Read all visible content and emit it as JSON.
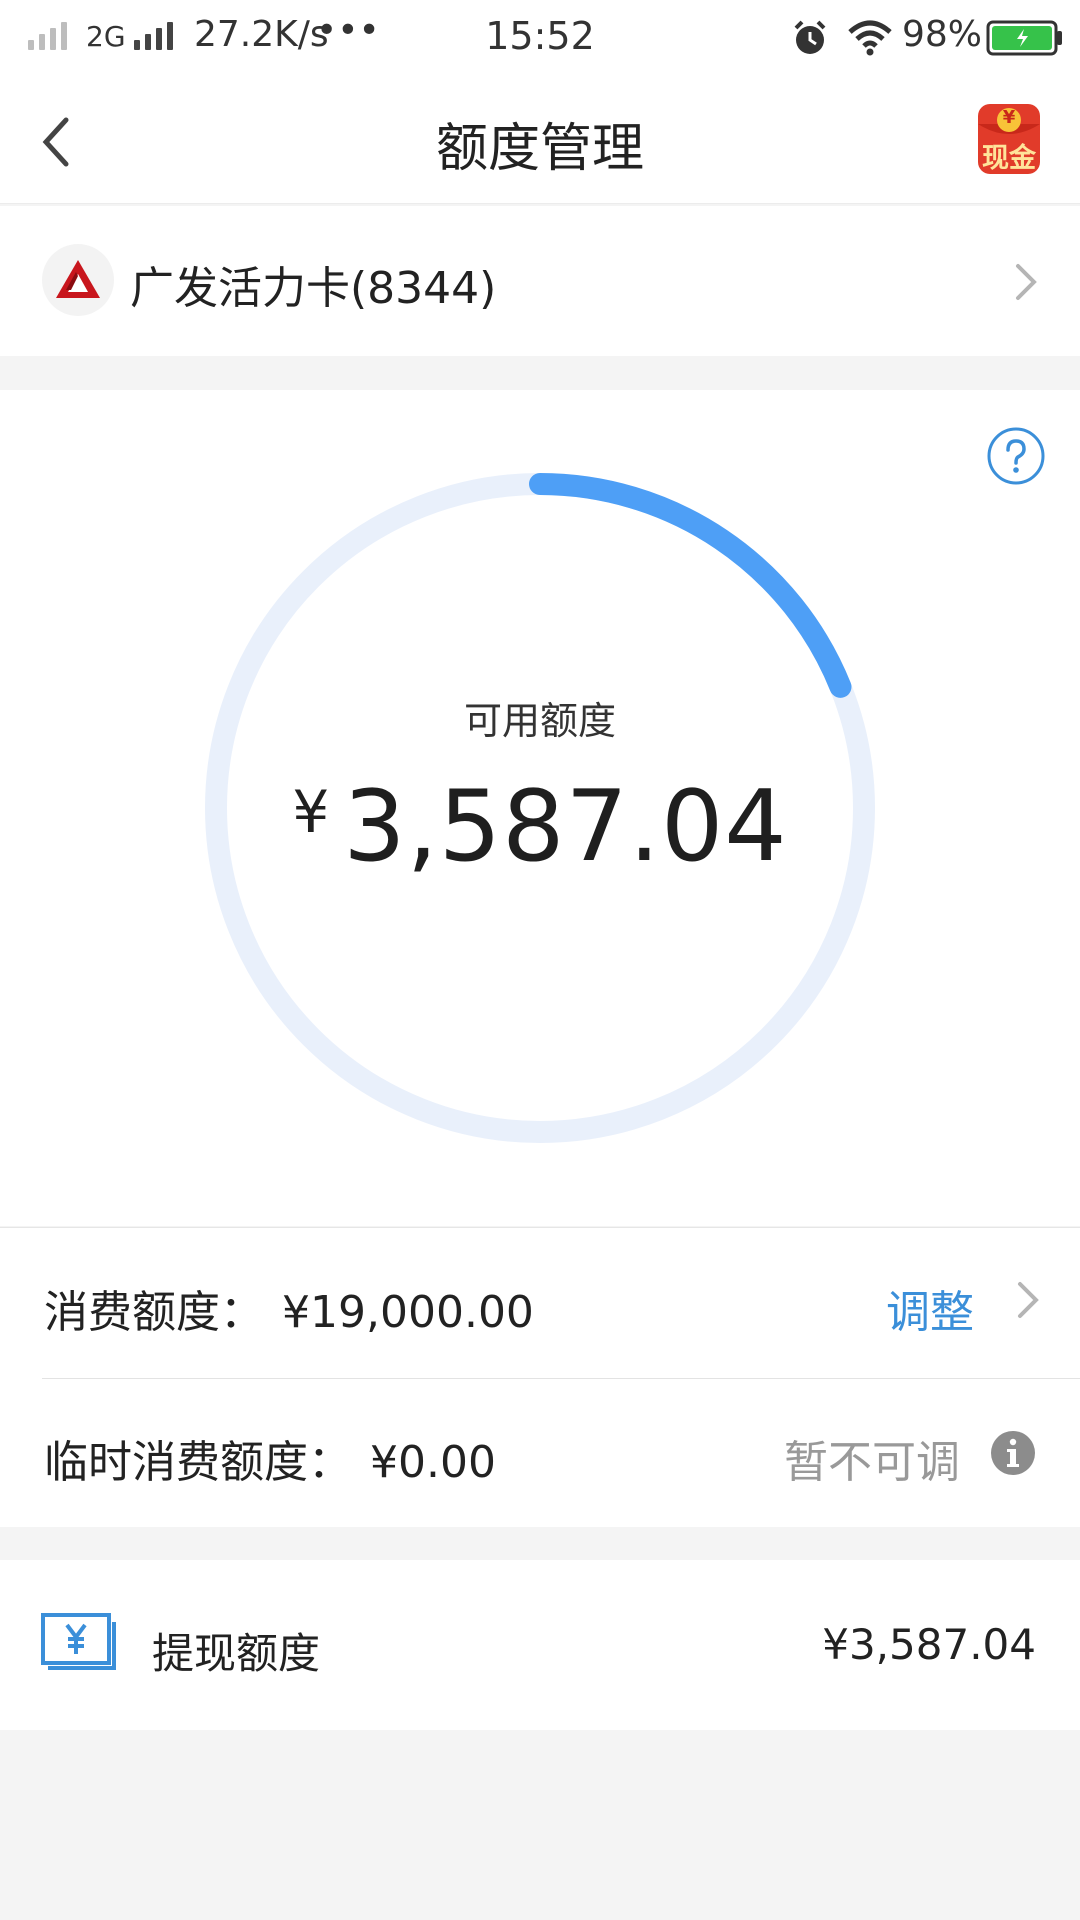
{
  "status_bar": {
    "network": "2G",
    "speed": "27.2K/s",
    "more": "•••",
    "time": "15:52",
    "battery": "98%",
    "icons": [
      "signal-icon",
      "alarm-icon",
      "wifi-icon",
      "battery-icon"
    ]
  },
  "nav": {
    "title": "额度管理",
    "back_icon": "chevron-left-icon",
    "promo_badge": {
      "top": "¥",
      "text": "现金"
    }
  },
  "card": {
    "name": "广发活力卡(8344)",
    "logo_icon": "bank-logo-icon",
    "chevron_icon": "chevron-right-icon"
  },
  "gauge": {
    "label": "可用额度",
    "currency": "¥",
    "amount": "3,587.04",
    "fill_fraction": 0.189,
    "help_icon": "question-icon",
    "track_color": "#e9f0fb",
    "fill_color": "#4e9ff6"
  },
  "limits": {
    "spend": {
      "label": "消费额度：",
      "value": "¥19,000.00",
      "action": "调整"
    },
    "temp": {
      "label": "临时消费额度：",
      "value": "¥0.00",
      "status": "暂不可调"
    }
  },
  "cash": {
    "label": "提现额度",
    "value": "¥3,587.04",
    "icon": "cash-note-icon"
  },
  "colors": {
    "accent": "#3b8fd9",
    "muted": "#999999"
  }
}
